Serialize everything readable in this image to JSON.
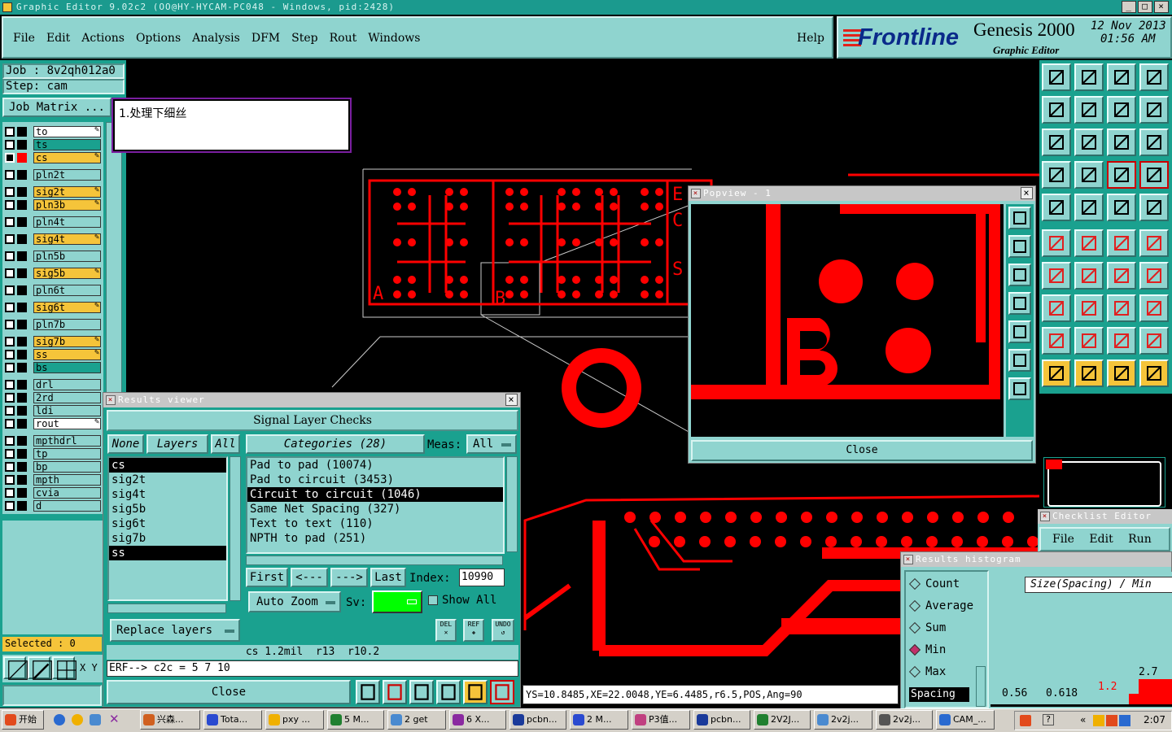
{
  "window": {
    "title": "Graphic Editor 9.02c2 (OO@HY-HYCAM-PC048 - Windows, pid:2428)"
  },
  "menu": {
    "items": [
      "File",
      "Edit",
      "Actions",
      "Options",
      "Analysis",
      "DFM",
      "Step",
      "Rout",
      "Windows"
    ],
    "help": "Help"
  },
  "brand": {
    "logo": "Frontline",
    "product": "Genesis 2000",
    "subtitle": "Graphic Editor",
    "date": "12 Nov 2013",
    "time": "01:56 AM"
  },
  "job": {
    "job_label": "Job : 8v2qh012a0",
    "step_label": "Step: cam",
    "matrix_button": "Job Matrix ..."
  },
  "note": {
    "text": "1.处理下细丝"
  },
  "layers": [
    {
      "name": "to",
      "color": "#ffffff",
      "mark": true
    },
    {
      "name": "ts",
      "color": "#1aa18f",
      "mark": false
    },
    {
      "name": "cs",
      "color": "#f5c43a",
      "mark": true
    },
    {
      "name": "pln2t",
      "color": "#8fd4cf",
      "mark": false
    },
    {
      "name": "sig2t",
      "color": "#f5c43a",
      "mark": true
    },
    {
      "name": "pln3b",
      "color": "#f5c43a",
      "mark": true
    },
    {
      "name": "pln4t",
      "color": "#8fd4cf",
      "mark": false
    },
    {
      "name": "sig4t",
      "color": "#f5c43a",
      "mark": true
    },
    {
      "name": "pln5b",
      "color": "#8fd4cf",
      "mark": false
    },
    {
      "name": "sig5b",
      "color": "#f5c43a",
      "mark": true
    },
    {
      "name": "pln6t",
      "color": "#8fd4cf",
      "mark": false
    },
    {
      "name": "sig6t",
      "color": "#f5c43a",
      "mark": true
    },
    {
      "name": "pln7b",
      "color": "#8fd4cf",
      "mark": false
    },
    {
      "name": "sig7b",
      "color": "#f5c43a",
      "mark": true
    },
    {
      "name": "ss",
      "color": "#f5c43a",
      "mark": true
    },
    {
      "name": "bs",
      "color": "#1aa18f",
      "mark": false
    },
    {
      "name": "drl",
      "color": "#8fd4cf",
      "mark": false
    },
    {
      "name": "2rd",
      "color": "#8fd4cf",
      "mark": false
    },
    {
      "name": "ldi",
      "color": "#8fd4cf",
      "mark": false
    },
    {
      "name": "rout",
      "color": "#ffffff",
      "mark": true
    },
    {
      "name": "mpthdrl",
      "color": "#8fd4cf",
      "mark": false
    },
    {
      "name": "tp",
      "color": "#8fd4cf",
      "mark": false
    },
    {
      "name": "bp",
      "color": "#8fd4cf",
      "mark": false
    },
    {
      "name": "mpth",
      "color": "#8fd4cf",
      "mark": false
    },
    {
      "name": "cvia",
      "color": "#8fd4cf",
      "mark": false
    },
    {
      "name": "d",
      "color": "#8fd4cf",
      "mark": false
    }
  ],
  "selected": {
    "label": "Selected : 0"
  },
  "bottom_left": {
    "xy": "X Y"
  },
  "results_viewer": {
    "title": "Results viewer",
    "header": "Signal Layer Checks",
    "none": "None",
    "layers": "Layers",
    "all": "All",
    "categories": "Categories (28)",
    "meas_label": "Meas:",
    "meas_value": "All",
    "layer_list": [
      "cs",
      "sig2t",
      "sig4t",
      "sig5b",
      "sig6t",
      "sig7b",
      "ss"
    ],
    "category_list": [
      "Pad to pad (10074)",
      "Pad to circuit (3453)",
      "Circuit to circuit (1046)",
      "Same Net Spacing (327)",
      "Text to text (110)",
      "NPTH to pad (251)"
    ],
    "first": "First",
    "prev": "<---",
    "next": "--->",
    "last": "Last",
    "index_label": "Index:",
    "index_value": "10990",
    "auto_zoom": "Auto Zoom",
    "sv": "Sv:",
    "show_all": "Show All",
    "del": "DEL",
    "ref": "REF",
    "undo": "UNDO",
    "replace_layers": "Replace layers",
    "status": "cs 1.2mil  r13  r10.2",
    "erf": "ERF--> c2c = 5 7 10",
    "close": "Close"
  },
  "popview": {
    "title": "Popview - 1",
    "close": "Close"
  },
  "coord_bar": {
    "text": "YS=10.8485,XE=22.0048,YE=6.4485,r6.5,POS,Ang=90"
  },
  "checklist_editor": {
    "title": "Checklist Editor",
    "menu": [
      "File",
      "Edit",
      "Run"
    ]
  },
  "histogram": {
    "title": "Results histogram",
    "options": [
      "Count",
      "Average",
      "Sum",
      "Min",
      "Max"
    ],
    "selected": "Min",
    "mode": "Spacing",
    "header": "Size(Spacing) / Min",
    "labels": [
      "0.56",
      "0.618",
      "1.2",
      "2.7"
    ]
  },
  "taskbar": {
    "start": "开始",
    "tasks": [
      "兴森...",
      "Tota...",
      "pxy ...",
      "5 M...",
      "2 get",
      "6 X...",
      "pcbn...",
      "2 M...",
      "P3值...",
      "pcbn...",
      "2V2J...",
      "2v2j...",
      "2v2j...",
      "CAM_..."
    ],
    "tray": "«",
    "clock": "2:07"
  },
  "board_labels": [
    "A",
    "B",
    "E",
    "C",
    "S"
  ],
  "colors": {
    "red": "#ff0000",
    "teal": "#8fd4cf",
    "yellow": "#f5c43a"
  }
}
